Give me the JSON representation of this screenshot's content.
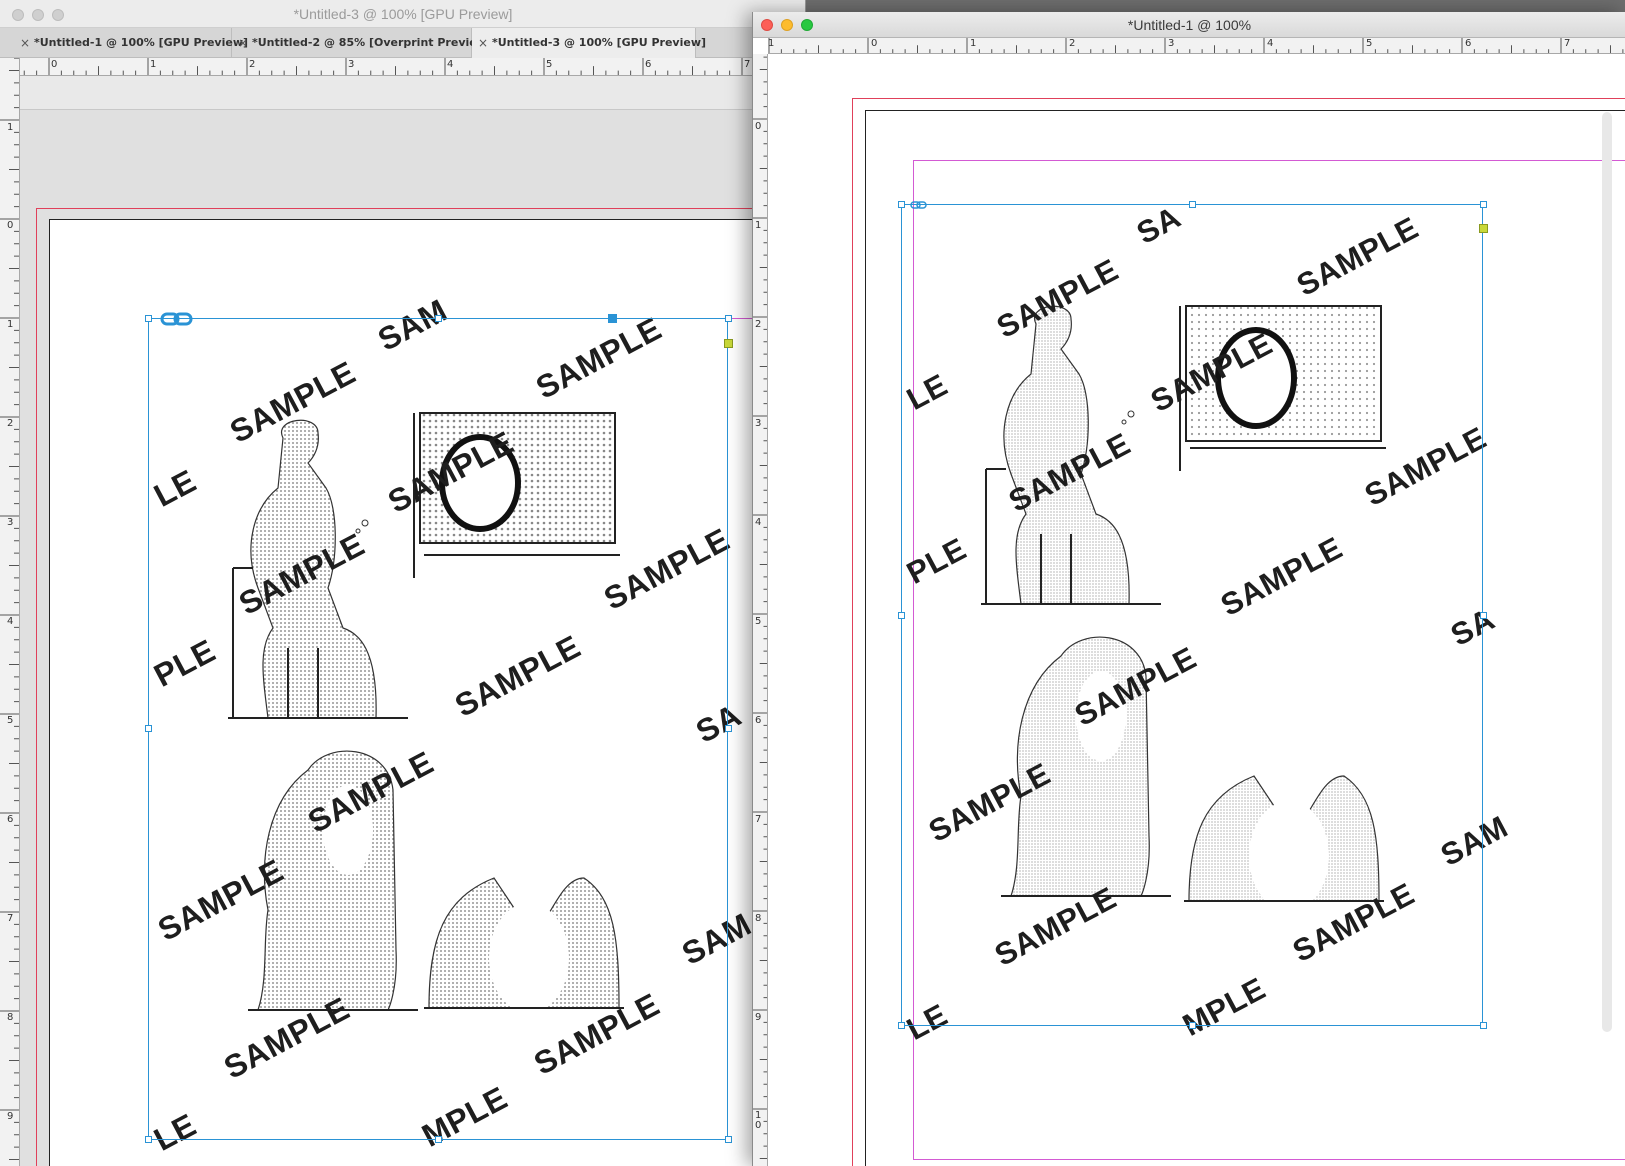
{
  "left_window": {
    "title": "*Untitled-3 @ 100% [GPU Preview]",
    "tabs": [
      {
        "label": "*Untitled-1 @ 100% [GPU Preview]",
        "close": "×"
      },
      {
        "label": "*Untitled-2 @ 85% [Overprint Preview]",
        "close": "×"
      },
      {
        "label": "*Untitled-3 @ 100% [GPU Preview]",
        "close": "×"
      }
    ],
    "h_ruler_labels": [
      "0",
      "1",
      "2",
      "3",
      "4",
      "5",
      "6",
      "7"
    ],
    "v_ruler_labels": [
      "1",
      "0",
      "1",
      "2",
      "3",
      "4",
      "5",
      "6",
      "7",
      "8",
      "9"
    ]
  },
  "right_window": {
    "title": "*Untitled-1 @ 100%",
    "h_ruler_labels": [
      "1",
      "0",
      "1",
      "2",
      "3",
      "4",
      "5",
      "6",
      "7"
    ],
    "v_ruler_labels": [
      "0",
      "1",
      "2",
      "3",
      "4",
      "5",
      "6",
      "7",
      "8",
      "9",
      "1\n0"
    ]
  },
  "watermark": {
    "full": "SAMPLE",
    "partial_le": "LE",
    "partial_ple": "PLE",
    "partial_sa": "SA",
    "partial_sam": "SAM",
    "partial_sa_top": "SA",
    "partial_mple": "MPLE"
  },
  "colors": {
    "selection": "#2a93d5",
    "bleed": "#e0405a",
    "margin": "#d35ad3",
    "traffic_red": "#fc5f57",
    "traffic_yellow": "#fdbc2e",
    "traffic_green": "#28c840"
  },
  "icons": [
    "link-icon",
    "close-icon"
  ]
}
